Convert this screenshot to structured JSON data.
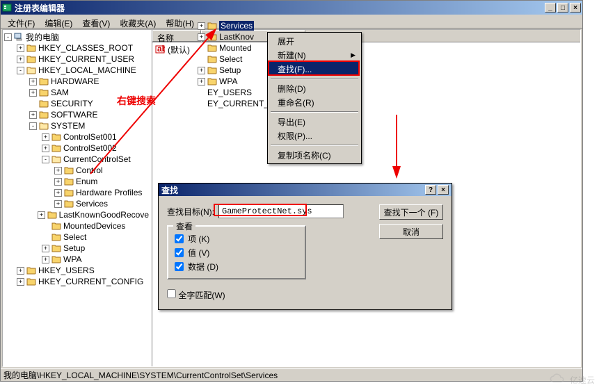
{
  "window": {
    "title": "注册表编辑器"
  },
  "menubar": [
    "文件(F)",
    "编辑(E)",
    "查看(V)",
    "收藏夹(A)",
    "帮助(H)"
  ],
  "tree": {
    "root": "我的电脑",
    "nodes": [
      {
        "label": "HKEY_CLASSES_ROOT",
        "indent": 1,
        "toggle": "+"
      },
      {
        "label": "HKEY_CURRENT_USER",
        "indent": 1,
        "toggle": "+"
      },
      {
        "label": "HKEY_LOCAL_MACHINE",
        "indent": 1,
        "toggle": "-"
      },
      {
        "label": "HARDWARE",
        "indent": 2,
        "toggle": "+"
      },
      {
        "label": "SAM",
        "indent": 2,
        "toggle": "+"
      },
      {
        "label": "SECURITY",
        "indent": 2,
        "toggle": ""
      },
      {
        "label": "SOFTWARE",
        "indent": 2,
        "toggle": "+"
      },
      {
        "label": "SYSTEM",
        "indent": 2,
        "toggle": "-"
      },
      {
        "label": "ControlSet001",
        "indent": 3,
        "toggle": "+"
      },
      {
        "label": "ControlSet002",
        "indent": 3,
        "toggle": "+"
      },
      {
        "label": "CurrentControlSet",
        "indent": 3,
        "toggle": "-"
      },
      {
        "label": "Control",
        "indent": 4,
        "toggle": "+"
      },
      {
        "label": "Enum",
        "indent": 4,
        "toggle": "+"
      },
      {
        "label": "Hardware Profiles",
        "indent": 4,
        "toggle": "+"
      },
      {
        "label": "Services",
        "indent": 4,
        "toggle": "+"
      },
      {
        "label": "LastKnownGoodRecove",
        "indent": 3,
        "toggle": "+"
      },
      {
        "label": "MountedDevices",
        "indent": 3,
        "toggle": ""
      },
      {
        "label": "Select",
        "indent": 3,
        "toggle": ""
      },
      {
        "label": "Setup",
        "indent": 3,
        "toggle": "+"
      },
      {
        "label": "WPA",
        "indent": 3,
        "toggle": "+"
      },
      {
        "label": "HKEY_USERS",
        "indent": 1,
        "toggle": "+"
      },
      {
        "label": "HKEY_CURRENT_CONFIG",
        "indent": 1,
        "toggle": "+"
      }
    ]
  },
  "list": {
    "header": "名称",
    "rows": [
      {
        "label": "(默认)"
      }
    ]
  },
  "right_tree": [
    {
      "label": "Services",
      "toggle": "+",
      "selected": true
    },
    {
      "label": "LastKnov",
      "toggle": "+"
    },
    {
      "label": "Mounted",
      "toggle": ""
    },
    {
      "label": "Select",
      "toggle": ""
    },
    {
      "label": "Setup",
      "toggle": "+"
    },
    {
      "label": "WPA",
      "toggle": "+"
    },
    {
      "label": "EY_USERS",
      "toggle": "",
      "noicon": true
    },
    {
      "label": "EY_CURRENT_",
      "toggle": "",
      "noicon": true
    }
  ],
  "context_menu": {
    "items": [
      {
        "label": "展开",
        "type": "item"
      },
      {
        "label": "新建(N)",
        "type": "sub"
      },
      {
        "label": "查找(F)...",
        "type": "item",
        "highlight": true
      },
      {
        "type": "sep"
      },
      {
        "label": "删除(D)",
        "type": "item"
      },
      {
        "label": "重命名(R)",
        "type": "item"
      },
      {
        "type": "sep"
      },
      {
        "label": "导出(E)",
        "type": "item"
      },
      {
        "label": "权限(P)...",
        "type": "item"
      },
      {
        "type": "sep"
      },
      {
        "label": "复制项名称(C)",
        "type": "item"
      }
    ]
  },
  "find": {
    "title": "查找",
    "target_label": "查找目标(N):",
    "target_value": "GameProtectNet.sys",
    "group_legend": "查看",
    "opt_key": "项 (K)",
    "opt_value": "值 (V)",
    "opt_data": "数据 (D)",
    "opt_match": "全字匹配(W)",
    "btn_next": "查找下一个 (F)",
    "btn_cancel": "取消"
  },
  "statusbar": "我的电脑\\HKEY_LOCAL_MACHINE\\SYSTEM\\CurrentControlSet\\Services",
  "annotation": {
    "text": "右键搜索"
  },
  "watermark": "亿速云"
}
